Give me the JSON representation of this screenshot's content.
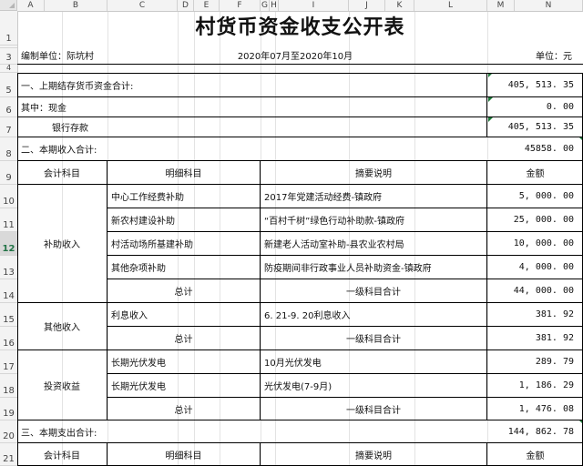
{
  "columns": [
    "A",
    "B",
    "C",
    "D",
    "E",
    "F",
    "G",
    "H",
    "I",
    "J",
    "K",
    "L",
    "M",
    "N"
  ],
  "rows": [
    "1",
    "2",
    "3",
    "4",
    "5",
    "6",
    "7",
    "8",
    "9",
    "10",
    "11",
    "12",
    "13",
    "14",
    "15",
    "16",
    "17",
    "18",
    "19",
    "20",
    "21"
  ],
  "selected_row": "12",
  "title": "村货币资金收支公开表",
  "header": {
    "unit_label": "编制单位：际坑村",
    "period": "2020年07月至2020年10月",
    "currency": "单位：元"
  },
  "section1": {
    "label": "一、上期结存货币资金合计:",
    "value": "405, 513. 35",
    "cash_label": "其中：现金",
    "cash_value": "0. 00",
    "bank_label": "银行存款",
    "bank_value": "405, 513. 35"
  },
  "section2": {
    "label": "二、本期收入合计:",
    "value": "45858. 00"
  },
  "table_headers": {
    "account": "会计科目",
    "detail": "明细科目",
    "summary": "摘要说明",
    "amount": "金额"
  },
  "income": {
    "subsidy": {
      "account": "补助收入",
      "items": [
        {
          "detail": "中心工作经费补助",
          "summary": "2017年党建活动经费-镇政府",
          "amount": "5, 000. 00"
        },
        {
          "detail": "新农村建设补助",
          "summary": "“百村千树”绿色行动补助款-镇政府",
          "amount": "25, 000. 00"
        },
        {
          "detail": "村活动场所基建补助",
          "summary": "新建老人活动室补助-县农业农村局",
          "amount": "10, 000. 00"
        },
        {
          "detail": "其他杂项补助",
          "summary": "防疫期间非行政事业人员补助资金-镇政府",
          "amount": "4, 000. 00"
        }
      ],
      "total_label": "总计",
      "total_summary": "一级科目合计",
      "total": "44, 000. 00"
    },
    "other": {
      "account": "其他收入",
      "items": [
        {
          "detail": "利息收入",
          "summary": "6. 21-9. 20利息收入",
          "amount": "381. 92"
        }
      ],
      "total_label": "总计",
      "total_summary": "一级科目合计",
      "total": "381. 92"
    },
    "investment": {
      "account": "投资收益",
      "items": [
        {
          "detail": "长期光伏发电",
          "summary": "10月光伏发电",
          "amount": "289. 79"
        },
        {
          "detail": "长期光伏发电",
          "summary": "光伏发电(7-9月)",
          "amount": "1, 186. 29"
        }
      ],
      "total_label": "总计",
      "total_summary": "一级科目合计",
      "total": "1, 476. 08"
    }
  },
  "section3": {
    "label": "三、本期支出合计:",
    "value": "144, 862. 78"
  },
  "colors": {
    "header_bg": "#f3f3f3",
    "selected_row_text": "#217346",
    "comment_marker": "#1f7a3a"
  }
}
